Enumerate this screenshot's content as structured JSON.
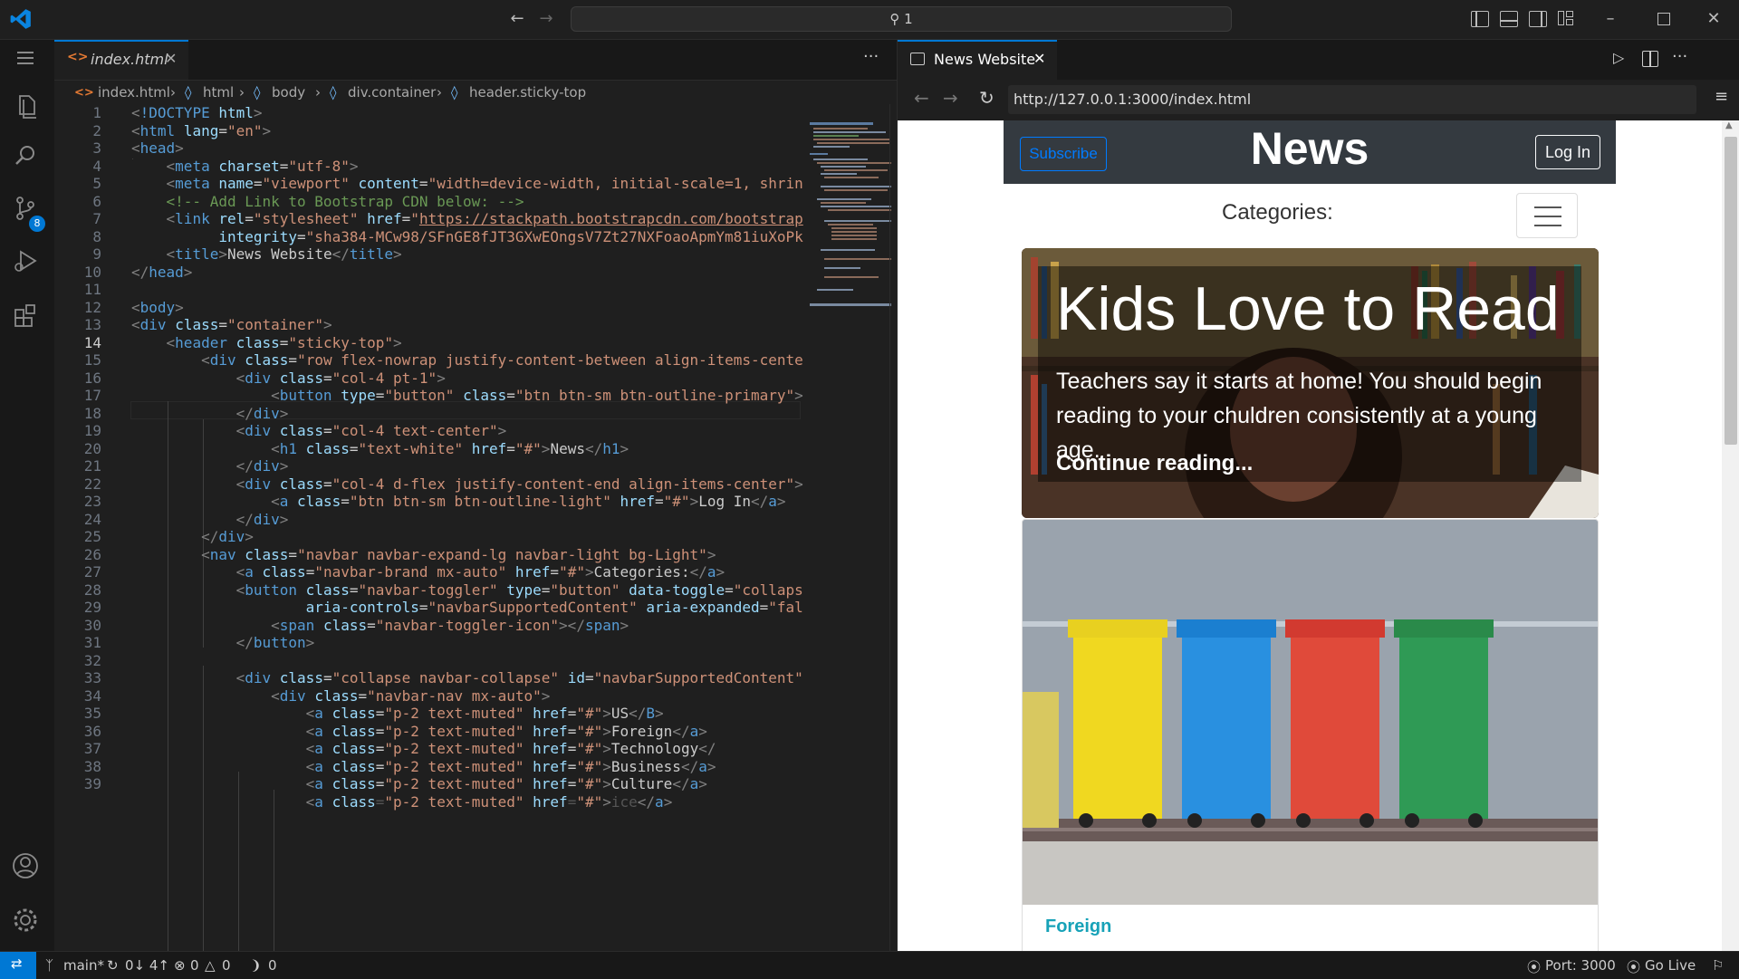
{
  "titlebar": {
    "command_center": "1"
  },
  "activity": {
    "source_control_badge": "8"
  },
  "editor": {
    "tab_label": "index.html",
    "breadcrumb": [
      "index.html",
      "html",
      "body",
      "div.container",
      "header.sticky-top"
    ],
    "line_numbers": [
      "1",
      "2",
      "3",
      "4",
      "5",
      "6",
      "7",
      "8",
      "9",
      "10",
      "11",
      "12",
      "13",
      "14",
      "15",
      "16",
      "17",
      "18",
      "19",
      "20",
      "21",
      "22",
      "23",
      "24",
      "25",
      "26",
      "27",
      "28",
      "29",
      "30",
      "31",
      "32",
      "33",
      "34",
      "35",
      "36",
      "37",
      "38",
      "39"
    ],
    "current_line": "14"
  },
  "browser": {
    "tab_label": "News Website",
    "url": "http://127.0.0.1:3000/index.html",
    "page": {
      "subscribe": "Subscribe",
      "title": "News",
      "login": "Log In",
      "categories": "Categories:",
      "hero_title": "Kids Love to Read",
      "hero_lead": "Teachers say it starts at home! You should begin reading to your chuldren consistently at a young age.",
      "hero_link": "Continue reading...",
      "card_category": "Foreign"
    }
  },
  "status": {
    "branch": "main*",
    "sync": "0↓ 4↑",
    "errors": "0",
    "warnings": "0",
    "ports": "0",
    "port": "Port: 3000",
    "golive": "Go Live"
  }
}
